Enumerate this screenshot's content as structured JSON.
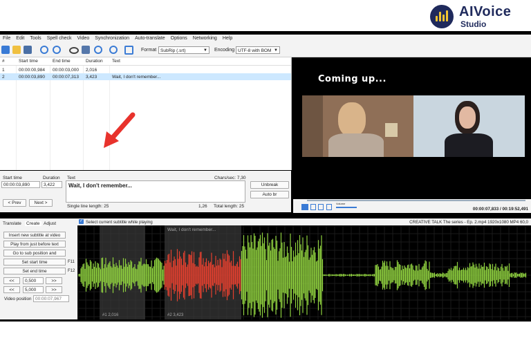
{
  "brand": {
    "title": "AIVoice",
    "subtitle": "Studio"
  },
  "menu": [
    "File",
    "Edit",
    "Tools",
    "Spell check",
    "Video",
    "Synchronization",
    "Auto-translate",
    "Options",
    "Networking",
    "Help"
  ],
  "toolbar": {
    "format_label": "Format",
    "format_value": "SubRip (.srt)",
    "encoding_label": "Encoding",
    "encoding_value": "UTF-8 with BOM"
  },
  "list": {
    "columns": [
      "#",
      "Start time",
      "End time",
      "Duration",
      "Text"
    ],
    "rows": [
      {
        "num": "1",
        "start": "00:00:00,984",
        "end": "00:00:03,000",
        "duration": "2,016",
        "text": ""
      },
      {
        "num": "2",
        "start": "00:00:03,890",
        "end": "00:00:07,313",
        "duration": "3,423",
        "text": "Wait, I don't remember..."
      }
    ]
  },
  "editor": {
    "start_label": "Start time",
    "duration_label": "Duration",
    "text_label": "Text",
    "chars_sec": "Chars/sec: 7,30",
    "start_value": "00:00:03,890",
    "duration_value": "3,422",
    "text_value": "Wait, I don't remember...",
    "unbreak": "Unbreak",
    "auto_br": "Auto br",
    "prev": "< Prev",
    "next": "Next >",
    "single_line": "Single line length: 25",
    "pos": "1,26",
    "total_length": "Total length: 25"
  },
  "video": {
    "overlay_text": "Coming up...",
    "time": "00:00:07,833 / 00:19:52,491",
    "volume_label": "Volume"
  },
  "panel": {
    "tabs": [
      "Translate",
      "Create",
      "Adjust"
    ],
    "buttons": [
      "Insert new subtitle at video",
      "Play from just before text",
      "Go to sub position and",
      "Set start time",
      "Set end time"
    ],
    "f11": "F11",
    "f12": "F12",
    "small_left": "<<",
    "small_right": ">>",
    "val1": "0,500",
    "val2": "5,000",
    "video_position_label": "Video position",
    "video_position_value": "00:00:07,967"
  },
  "waveform": {
    "checkbox_label": "Select current subtitle while playing",
    "file_info": "CREATIVE TALK The series - Ep. 2.mp4 1920x1080 MP4 60,0",
    "sub_text": "Wait, I don't remember...",
    "label1": "#1  2,016",
    "label2": "#2  3,423",
    "green": "#8fd13f",
    "red": "#e5402f"
  },
  "colors": {
    "selected_row": "#cde8ff",
    "accent": "#1f2a5c",
    "arrow": "#e8322c"
  }
}
